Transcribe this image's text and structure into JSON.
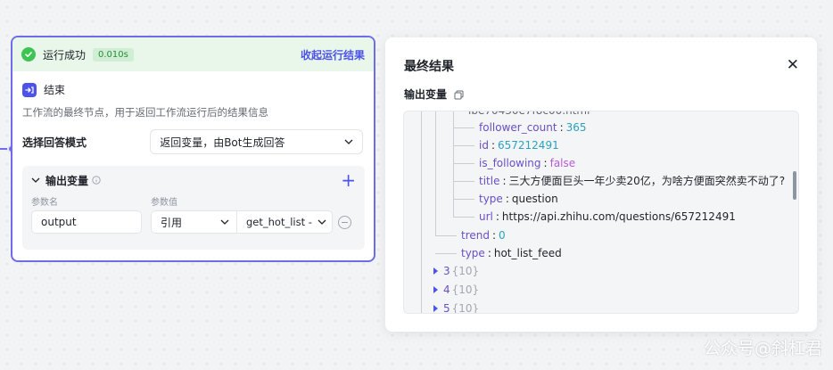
{
  "node": {
    "run_status": "运行成功",
    "run_time": "0.010s",
    "collapse_link": "收起运行结果",
    "title": "结束",
    "description": "工作流的最终节点，用于返回工作流运行后的结果信息",
    "mode_label": "选择回答模式",
    "mode_value": "返回变量，由Bot生成回答",
    "output": {
      "title": "输出变量",
      "col_name": "参数名",
      "col_value": "参数值",
      "param_name": "output",
      "param_type": "引用",
      "param_ref": "get_hot_list -"
    }
  },
  "result": {
    "title": "最终结果",
    "output_label": "输出变量",
    "json_lines": [
      {
        "key": "follower_count",
        "value": "365",
        "kind": "num"
      },
      {
        "key": "id",
        "value": "657212491",
        "kind": "num"
      },
      {
        "key": "is_following",
        "value": "false",
        "kind": "bool"
      },
      {
        "key": "title",
        "value": "三大方便面巨头一年少卖20亿，为啥方便面突然卖不动了?",
        "kind": "str"
      },
      {
        "key": "type",
        "value": "question",
        "kind": "str"
      },
      {
        "key": "url",
        "value": "https://api.zhihu.com/questions/657212491",
        "kind": "str"
      },
      {
        "key": "trend",
        "value": "0",
        "kind": "num"
      },
      {
        "key": "type",
        "value": "hot_list_feed",
        "kind": "str"
      }
    ],
    "collapsed_items": [
      {
        "index": "3",
        "meta": "{10}"
      },
      {
        "index": "4",
        "meta": "{10}"
      },
      {
        "index": "5",
        "meta": "{10}"
      }
    ]
  },
  "watermark": "公众号@斜杠君",
  "colors": {
    "accent": "#4d53e8",
    "success": "#3ec452",
    "node_border": "#6e6ce8"
  }
}
